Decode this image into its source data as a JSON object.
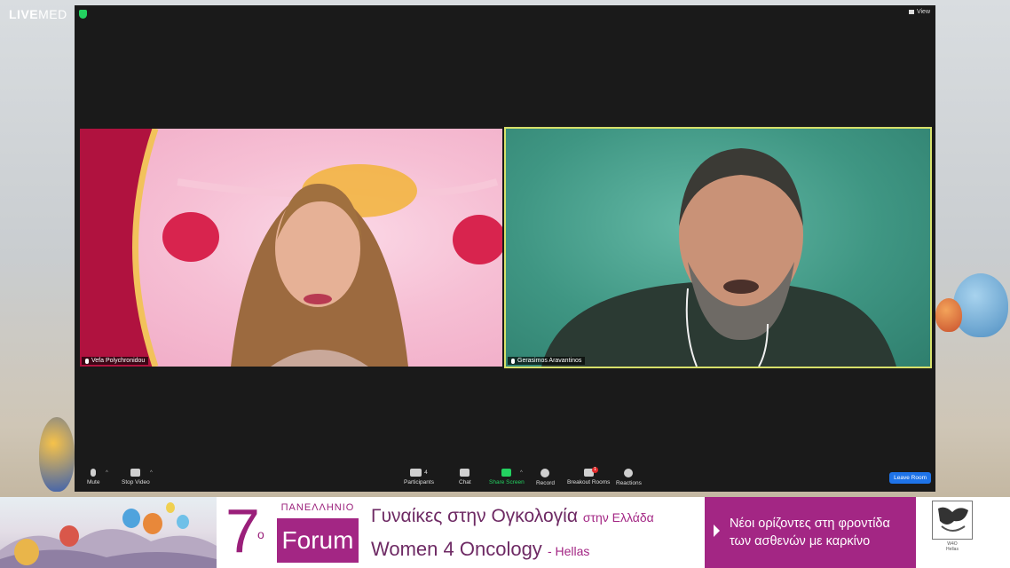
{
  "brand": {
    "live": "LIVE",
    "med": "MED"
  },
  "meeting": {
    "view_label": "View",
    "participants_tiles": [
      {
        "name": "Vefa Polychronidou"
      },
      {
        "name": "Gerasimos Aravantinos"
      }
    ],
    "toolbar": {
      "mute": "Mute",
      "stop_video": "Stop Video",
      "participants": "Participants",
      "participants_count": "4",
      "chat": "Chat",
      "share_screen": "Share Screen",
      "record": "Record",
      "breakout_rooms": "Breakout Rooms",
      "breakout_badge": "1",
      "reactions": "Reactions",
      "leave_room": "Leave Room"
    },
    "colors": {
      "share_green": "#23d160",
      "leave_blue": "#1e73e8",
      "active_speaker_border": "#d7e06a"
    }
  },
  "banner": {
    "number": "7",
    "number_suffix": "ο",
    "panellinio": "ΠΑΝΕΛΛΗΝΙΟ",
    "forum": "Forum",
    "title_gr": "Γυναίκες στην Ογκολογία",
    "title_gr_sub": "στην Ελλάδα",
    "title_en": "Women 4 Oncology",
    "title_en_sub": "- Hellas",
    "tagline_line1": "Νέοι ορίζοντες στη φροντίδα",
    "tagline_line2": "των ασθενών με καρκίνο",
    "logo_text_1": "W4O",
    "logo_text_2": "Hellas",
    "colors": {
      "brand_purple": "#a32684"
    }
  }
}
